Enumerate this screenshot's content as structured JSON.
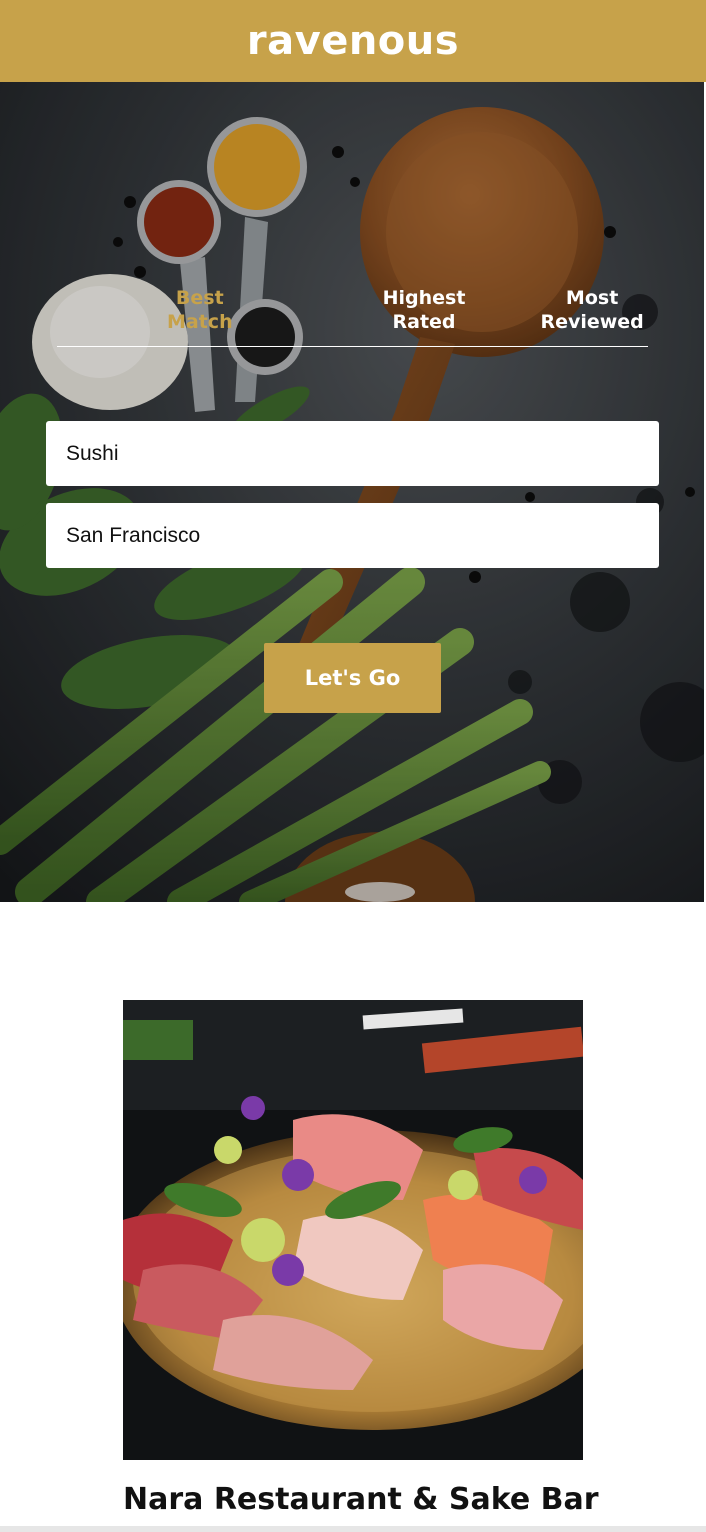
{
  "app": {
    "brand": "ravenous"
  },
  "sort": {
    "options": [
      {
        "label": "Best Match",
        "active": true
      },
      {
        "label": "Highest Rated",
        "active": false
      },
      {
        "label": "Most Reviewed",
        "active": false
      }
    ]
  },
  "search": {
    "term_value": "Sushi",
    "location_value": "San Francisco",
    "submit_label": "Let's Go"
  },
  "results": [
    {
      "name": "Nara Restaurant & Sake Bar"
    }
  ],
  "colors": {
    "accent": "#c7a24a",
    "background": "#ffffff",
    "hero_dark": "#2f3337"
  },
  "icons": {
    "hero_photo": "food-ingredients-photo",
    "result_photo": "sashimi-platter-photo"
  }
}
